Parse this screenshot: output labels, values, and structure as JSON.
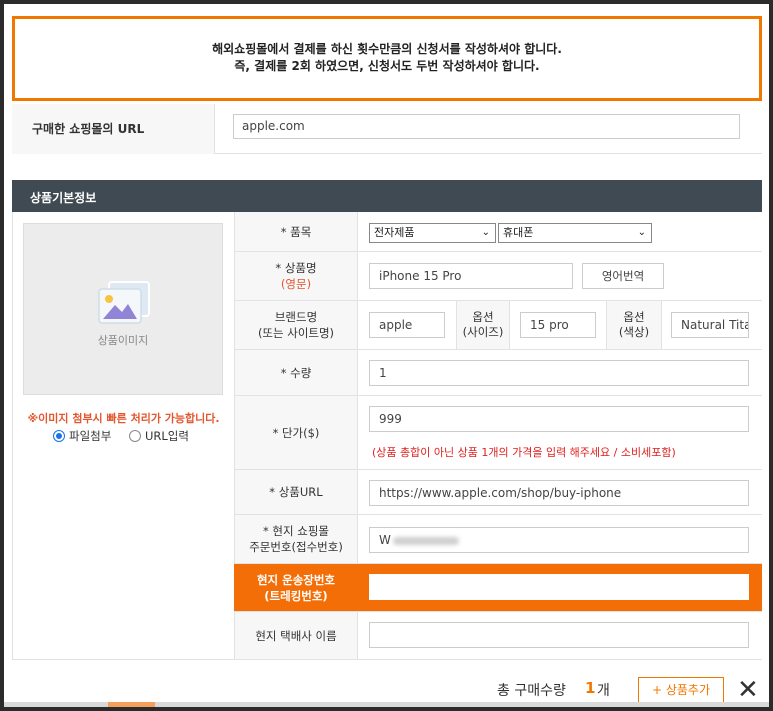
{
  "notice": {
    "line1": "해외쇼핑몰에서 결제를 하신 횟수만큼의 신청서를 작성하셔야 합니다.",
    "line2": "즉, 결제를 2회 하였으면, 신청서도 두번 작성하셔야 합니다."
  },
  "url_row": {
    "label": "구매한 쇼핑몰의 URL",
    "value": "apple.com"
  },
  "section_title": "상품기본정보",
  "image_panel": {
    "placeholder_text": "상품이미지",
    "icon": "image-icon",
    "note": "※이미지 첨부시 빠른 처리가 가능합니다.",
    "radio_options": [
      "파일첨부",
      "URL입력"
    ],
    "radio_selected": "파일첨부"
  },
  "form": {
    "category": {
      "label": "* 품목",
      "select1": "전자제품",
      "select2": "휴대폰"
    },
    "product_name": {
      "label": "* 상품명",
      "sub": "(영문)",
      "value": "iPhone 15 Pro",
      "button": "영어번역"
    },
    "brand": {
      "label": "브랜드명",
      "sub": "(또는 사이트명)",
      "value": "apple"
    },
    "option_size": {
      "label": "옵션",
      "sub": "(사이즈)",
      "value": "15 pro"
    },
    "option_color": {
      "label": "옵션",
      "sub": "(색상)",
      "value": "Natural Tita"
    },
    "quantity": {
      "label": "* 수량",
      "value": "1"
    },
    "unit_price": {
      "label": "* 단가($)",
      "value": "999",
      "hint": "(상품 총합이 아닌 상품 1개의 가격을 입력 해주세요 / 소비세포함)"
    },
    "product_url": {
      "label": "* 상품URL",
      "value": "https://www.apple.com/shop/buy-iphone"
    },
    "order_number": {
      "label": "* 현지 쇼핑몰",
      "sub": "주문번호(접수번호)",
      "value_prefix": "W"
    },
    "tracking": {
      "label": "현지 운송장번호",
      "sub": "(트레킹번호)",
      "value": ""
    },
    "courier": {
      "label": "현지 택배사 이름",
      "value": ""
    }
  },
  "footer": {
    "total_label": "총 구매수량",
    "total_count": "1",
    "total_unit": "개",
    "add_button": "+ 상품추가",
    "close_icon": "close-icon"
  },
  "colors": {
    "accent": "#f07800",
    "section_bar": "#404a52",
    "tracking_row": "#f46e07",
    "hint": "#e02020"
  }
}
